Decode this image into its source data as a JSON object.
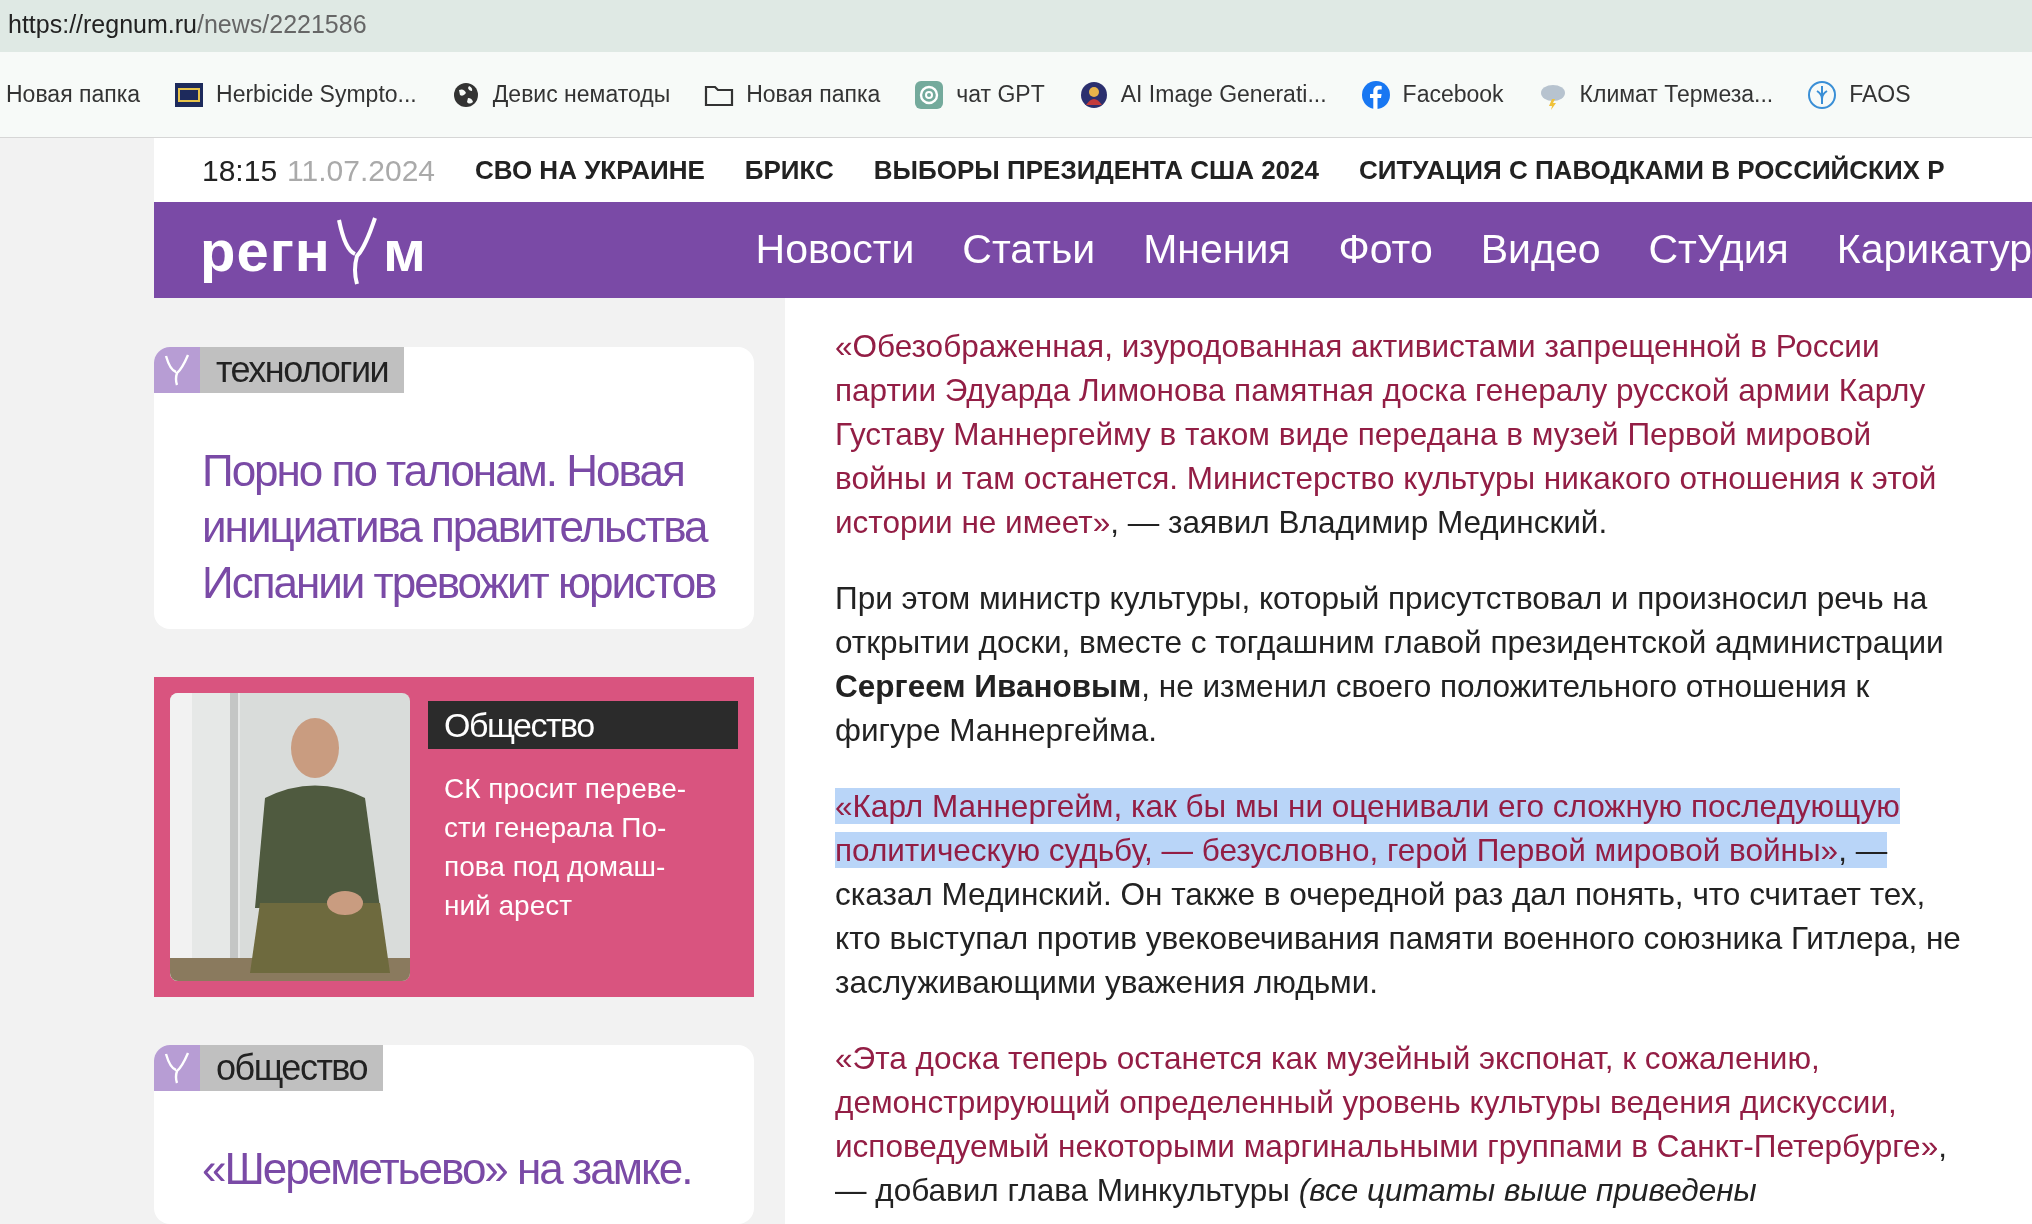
{
  "address_bar": {
    "url_host": "https://regnum.ru",
    "url_path": "/news/2221586"
  },
  "bookmarks": [
    {
      "label": "Новая папка",
      "kind": "plain"
    },
    {
      "label": "Herbicide Sympto...",
      "kind": "site"
    },
    {
      "label": "Девис нематоды",
      "kind": "site"
    },
    {
      "label": "Новая папка",
      "kind": "folder"
    },
    {
      "label": "чат GPT",
      "kind": "site"
    },
    {
      "label": "AI Image Generati...",
      "kind": "site"
    },
    {
      "label": "Facebook",
      "kind": "site"
    },
    {
      "label": "Климат Термеза...",
      "kind": "site"
    },
    {
      "label": "FAOS",
      "kind": "site"
    }
  ],
  "top_strip": {
    "time": "18:15",
    "date": "11.07.2024",
    "links": [
      "СВО НА УКРАИНЕ",
      "БРИКС",
      "ВЫБОРЫ ПРЕЗИДЕНТА США 2024",
      "СИТУАЦИЯ С ПАВОДКАМИ В РОССИЙСКИХ Р"
    ]
  },
  "site_header": {
    "logo_start": "регн",
    "logo_end": "м",
    "nav": [
      "Новости",
      "Статьи",
      "Мнения",
      "Фото",
      "Видео",
      "СтУдия",
      "Карикатур"
    ]
  },
  "sidebar_cards": [
    {
      "kind": "text",
      "tag": "технологии",
      "lines": [
        "Порно по талонам. Новая",
        "инициатива правительства",
        "Испании тревожит юристов"
      ]
    },
    {
      "tag": "Общество",
      "lines": [
        "СК просит переве-",
        "сти генерала По-",
        "пова под домаш-",
        "ний арест"
      ]
    },
    {
      "kind": "text",
      "tag": "общество",
      "lines": [
        "«Шереметьево» на замке."
      ]
    }
  ],
  "article": {
    "paragraphs": [
      {
        "segments": [
          {
            "kind": "quote",
            "selected": false,
            "text": "«Обезображенная, изуродованная активистами запрещенной в России партии Эдуарда Лимонова памятная доска генералу русской армии Карлу Густаву Маннергейму в таком виде передана в музей Первой мировой войны и там останется. Министерство культуры никакого отношения к этой истории не имеет»"
          },
          {
            "kind": "plain",
            "selected": false,
            "text": ", — заявил Владимир Мединский."
          }
        ]
      },
      {
        "segments": [
          {
            "kind": "plain",
            "selected": false,
            "text": "При этом министр культуры, который присутствовал и произносил речь на открытии доски, вместе с тогдашним главой президентской администрации "
          },
          {
            "kind": "bold",
            "selected": false,
            "text": "Сергеем Ивановым"
          },
          {
            "kind": "plain",
            "selected": false,
            "text": ", не изменил своего положительного отношения к фигуре Маннергейма."
          }
        ]
      },
      {
        "segments": [
          {
            "kind": "quote",
            "selected": true,
            "text": "«Карл Маннергейм, как бы мы ни оценивали его сложную последующую политическую судьбу, — безусловно, герой Первой мировой войны»"
          },
          {
            "kind": "plain",
            "selected": true,
            "text": ", —"
          },
          {
            "kind": "plain",
            "selected": false,
            "text": " сказал Мединский. Он также в очередной раз дал понять, что считает тех, кто выступал против увековечивания памяти военного союзника Гитлера, не заслуживающими уважения людьми."
          }
        ]
      },
      {
        "segments": [
          {
            "kind": "quote",
            "selected": false,
            "text": "«Эта доска теперь останется как музейный экспонат, к сожалению, демонстрирующий определенный уровень культуры ведения дискуссии, исповедуемый некоторыми маргинальными группами в Санкт-Петербурге»"
          },
          {
            "kind": "plain",
            "selected": false,
            "text": ", — добавил глава Минкультуры "
          },
          {
            "kind": "italic",
            "selected": false,
            "text": "(все цитаты выше приведены"
          }
        ]
      }
    ]
  }
}
